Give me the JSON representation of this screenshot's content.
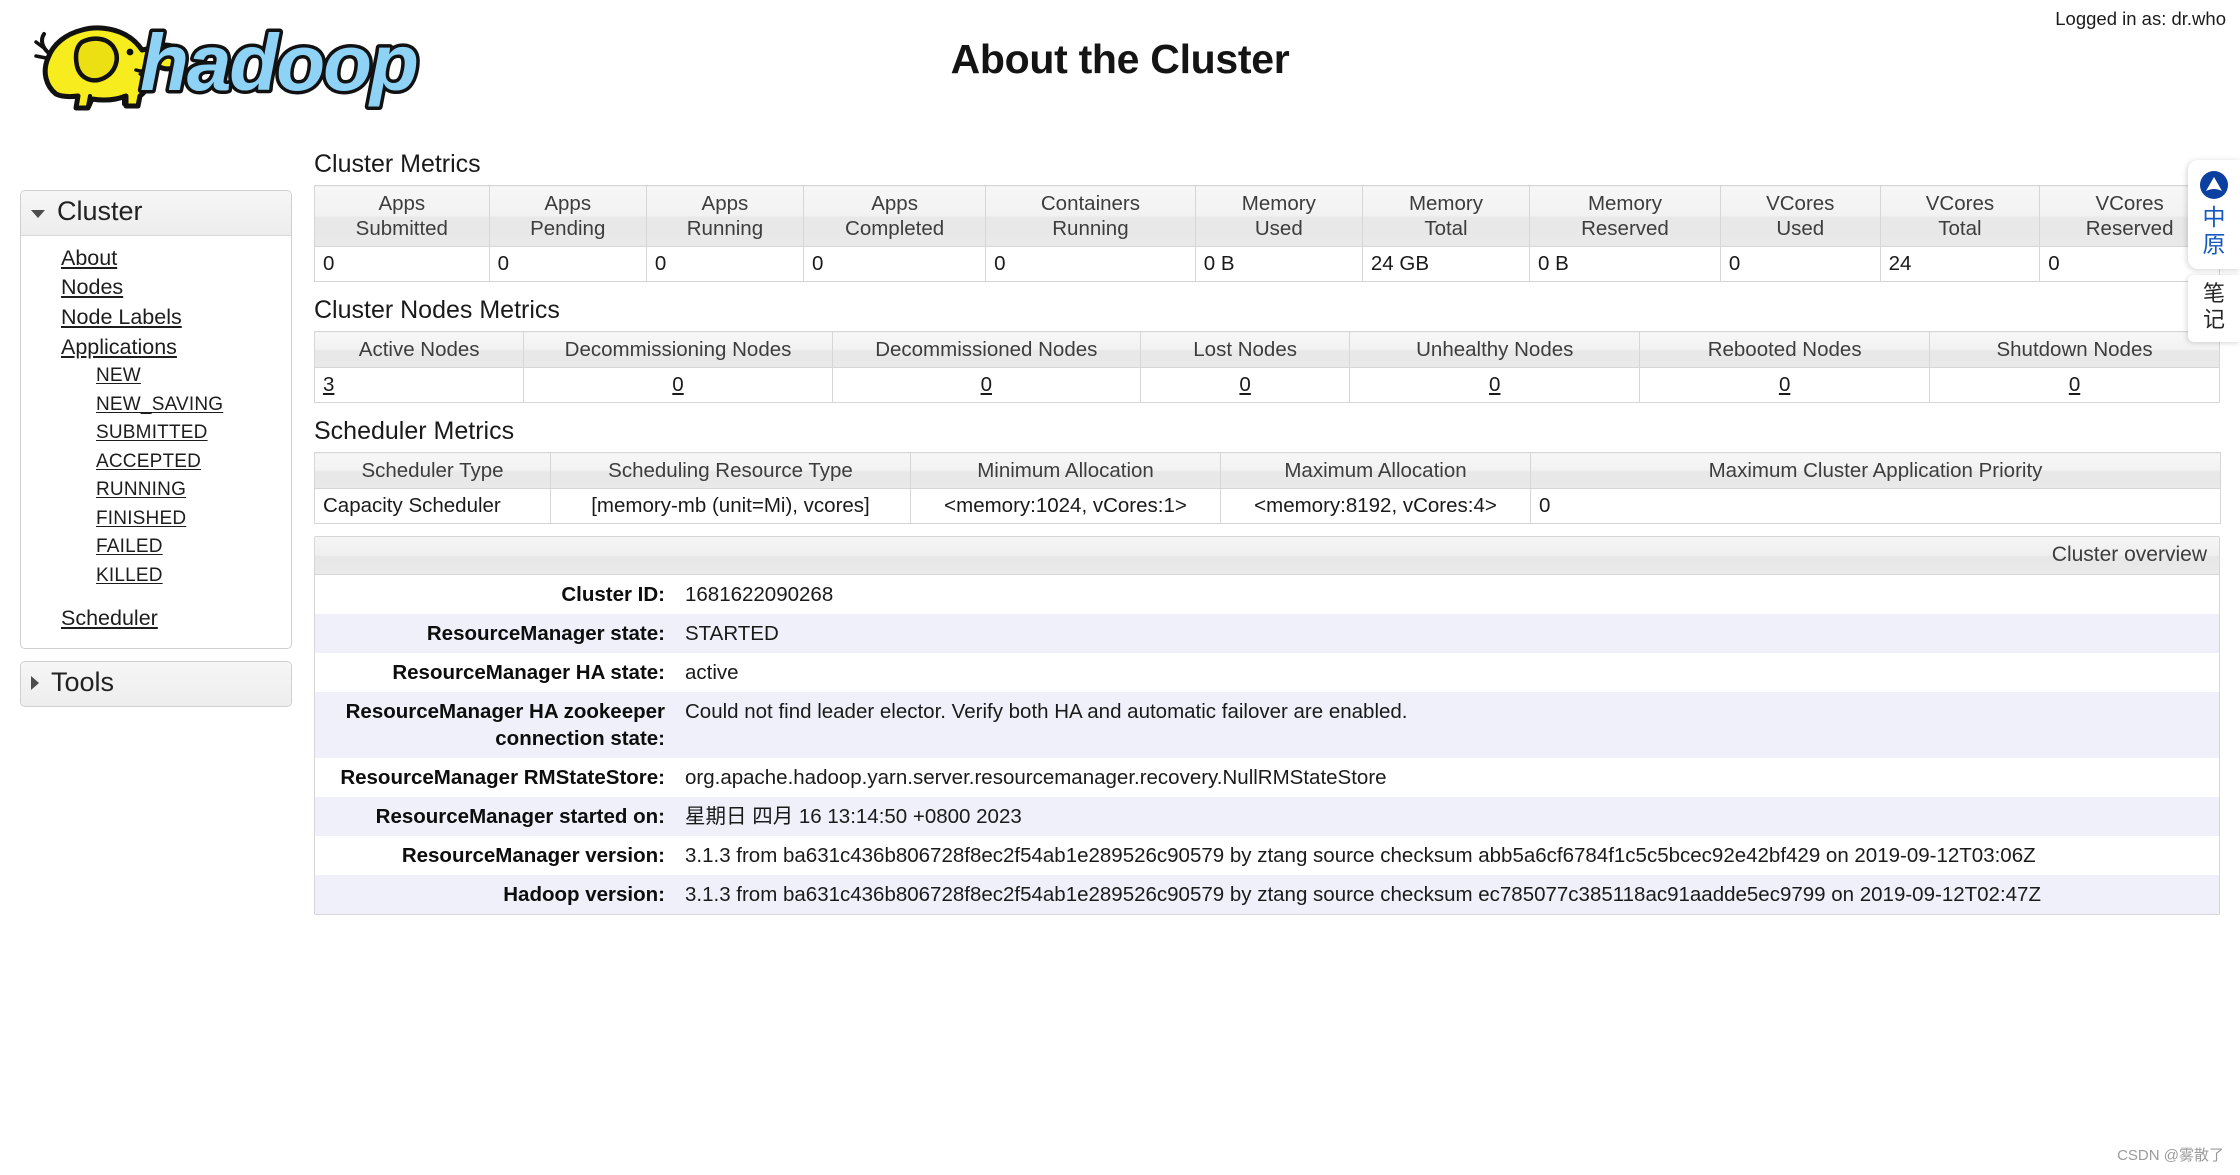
{
  "header": {
    "title": "About the Cluster",
    "login_label": "Logged in as: dr.who",
    "logo_text": "hadoop"
  },
  "sidebar": {
    "cluster": {
      "label": "Cluster",
      "expanded": true,
      "items": [
        {
          "label": "About"
        },
        {
          "label": "Nodes"
        },
        {
          "label": "Node Labels"
        },
        {
          "label": "Applications"
        }
      ],
      "app_states": [
        {
          "label": "NEW"
        },
        {
          "label": "NEW_SAVING"
        },
        {
          "label": "SUBMITTED"
        },
        {
          "label": "ACCEPTED"
        },
        {
          "label": "RUNNING"
        },
        {
          "label": "FINISHED"
        },
        {
          "label": "FAILED"
        },
        {
          "label": "KILLED"
        }
      ],
      "scheduler": {
        "label": "Scheduler"
      }
    },
    "tools": {
      "label": "Tools",
      "expanded": false
    }
  },
  "main": {
    "cluster_metrics": {
      "title": "Cluster Metrics",
      "headers": [
        "Apps\nSubmitted",
        "Apps\nPending",
        "Apps\nRunning",
        "Apps\nCompleted",
        "Containers\nRunning",
        "Memory\nUsed",
        "Memory\nTotal",
        "Memory\nReserved",
        "VCores\nUsed",
        "VCores\nTotal",
        "VCores\nReserved"
      ],
      "header_lines": [
        [
          "Apps",
          "Submitted"
        ],
        [
          "Apps",
          "Pending"
        ],
        [
          "Apps",
          "Running"
        ],
        [
          "Apps",
          "Completed"
        ],
        [
          "Containers",
          "Running"
        ],
        [
          "Memory",
          "Used"
        ],
        [
          "Memory",
          "Total"
        ],
        [
          "Memory",
          "Reserved"
        ],
        [
          "VCores",
          "Used"
        ],
        [
          "VCores",
          "Total"
        ],
        [
          "VCores",
          "Reserved"
        ]
      ],
      "values": [
        "0",
        "0",
        "0",
        "0",
        "0",
        "0 B",
        "24 GB",
        "0 B",
        "0",
        "24",
        "0"
      ]
    },
    "nodes_metrics": {
      "title": "Cluster Nodes Metrics",
      "headers": [
        "Active Nodes",
        "Decommissioning Nodes",
        "Decommissioned Nodes",
        "Lost Nodes",
        "Unhealthy Nodes",
        "Rebooted Nodes",
        "Shutdown Nodes"
      ],
      "values": [
        "3",
        "0",
        "0",
        "0",
        "0",
        "0",
        "0"
      ]
    },
    "scheduler_metrics": {
      "title": "Scheduler Metrics",
      "headers": [
        "Scheduler Type",
        "Scheduling Resource Type",
        "Minimum Allocation",
        "Maximum Allocation",
        "Maximum Cluster Application Priority"
      ],
      "values": [
        "Capacity Scheduler",
        "[memory-mb (unit=Mi), vcores]",
        "<memory:1024, vCores:1>",
        "<memory:8192, vCores:4>",
        "0"
      ]
    },
    "overview": {
      "caption": "Cluster overview",
      "rows": [
        {
          "key": "Cluster ID:",
          "value": "1681622090268"
        },
        {
          "key": "ResourceManager state:",
          "value": "STARTED"
        },
        {
          "key": "ResourceManager HA state:",
          "value": "active"
        },
        {
          "key": "ResourceManager HA zookeeper connection state:",
          "value": "Could not find leader elector. Verify both HA and automatic failover are enabled."
        },
        {
          "key": "ResourceManager RMStateStore:",
          "value": "org.apache.hadoop.yarn.server.resourcemanager.recovery.NullRMStateStore"
        },
        {
          "key": "ResourceManager started on:",
          "value": "星期日 四月 16 13:14:50 +0800 2023"
        },
        {
          "key": "ResourceManager version:",
          "value": "3.1.3 from ba631c436b806728f8ec2f54ab1e289526c90579 by ztang source checksum abb5a6cf6784f1c5c5bcec92e42bf429 on 2019-09-12T03:06Z"
        },
        {
          "key": "Hadoop version:",
          "value": "3.1.3 from ba631c436b806728f8ec2f54ab1e289526c90579 by ztang source checksum ec785077c385118ac91aadde5ec9799 on 2019-09-12T02:47Z"
        }
      ]
    }
  },
  "float_widget": {
    "line1": "中",
    "line2": "原",
    "note1": "笔",
    "note2": "记",
    "accent_color": "#1559c4"
  },
  "watermark": "CSDN @雾散了"
}
